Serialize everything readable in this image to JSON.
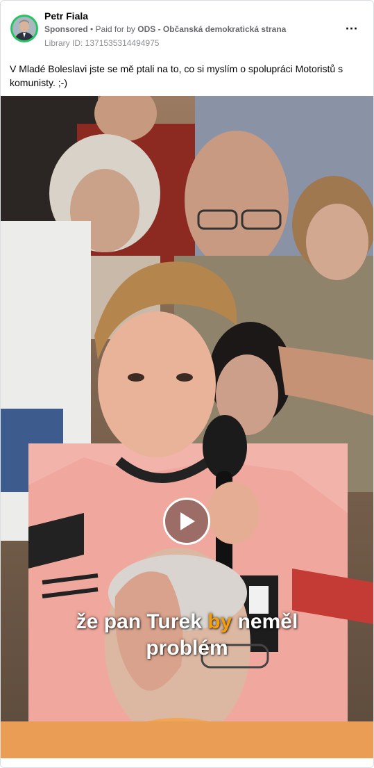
{
  "post": {
    "page_name": "Petr Fiala",
    "sponsored_label": "Sponsored",
    "separator": " • ",
    "paid_for_prefix": "Paid for by ",
    "payer": "ODS - Občanská demokratická strana",
    "library_id": "Library ID: 1371535314494975",
    "more_icon": "⋯",
    "caption": "V Mladé Boleslavi jste se mě ptali na to, co si myslím o spolupráci Motoristů s komunisty. ;-)"
  },
  "video": {
    "play_icon": "play-icon",
    "subtitle_line1_before": "že pan Turek ",
    "subtitle_line1_highlight": "by",
    "subtitle_line1_after": " neměl",
    "subtitle_line2": "problém"
  },
  "colors": {
    "avatar_ring": "#22c55e",
    "subtitle_highlight": "#f59e0b",
    "text_primary": "#050505",
    "text_secondary": "#65676b"
  }
}
